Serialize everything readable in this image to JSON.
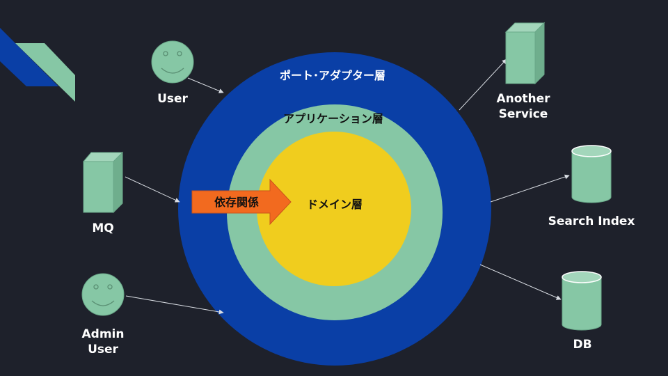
{
  "colors": {
    "background": "#1e212b",
    "port_adapter": "#0a3fa6",
    "application": "#86c7a5",
    "domain": "#f0cd1e",
    "dependency_arrow": "#f26a1f",
    "node_fill": "#86c7a5",
    "text_light": "#ffffff",
    "text_dark": "#111111"
  },
  "layers": {
    "port_adapter": "ポート･アダプター層",
    "application": "アプリケーション層",
    "domain": "ドメイン層"
  },
  "dependency_label": "依存関係",
  "actors": {
    "user": "User",
    "mq": "MQ",
    "admin_user": [
      "Admin",
      "User"
    ]
  },
  "externals": {
    "another_service": [
      "Another",
      "Service"
    ],
    "search_index": "Search Index",
    "db": "DB"
  },
  "icons": [
    "smiley-face-icon",
    "server-box-icon",
    "database-cylinder-icon",
    "logo-chevron-icon"
  ]
}
